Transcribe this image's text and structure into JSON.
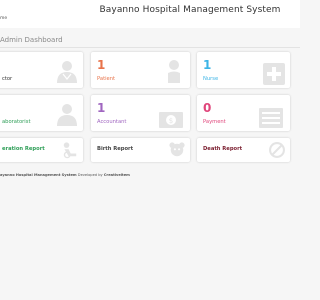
{
  "header": {
    "home_label": "me",
    "title": "Bayanno Hospital Management System"
  },
  "breadcrumb": "Admin Dashboard",
  "cards_row1": [
    {
      "number": "",
      "label": "ctor",
      "color": "#333333",
      "icon": "doctor-icon"
    },
    {
      "number": "1",
      "label": "Patient",
      "color": "#e8734a",
      "icon": "patient-icon"
    },
    {
      "number": "1",
      "label": "Nurse",
      "color": "#3cb4e6",
      "icon": "nurse-plus-icon"
    }
  ],
  "cards_row2": [
    {
      "number": "",
      "label": "aboratorist",
      "color": "#2e9e57",
      "icon": "laboratorist-icon"
    },
    {
      "number": "1",
      "label": "Accountant",
      "color": "#a066c0",
      "icon": "money-icon"
    },
    {
      "number": "0",
      "label": "Payment",
      "color": "#e0457b",
      "icon": "payment-list-icon"
    }
  ],
  "cards_row3": [
    {
      "label": "eration Report",
      "color": "#2e9e57",
      "icon": "operation-icon"
    },
    {
      "label": "Birth Report",
      "color": "#444444",
      "icon": "birth-icon"
    },
    {
      "label": "Death Report",
      "color": "#7a1d2e",
      "icon": "death-icon"
    }
  ],
  "footer": {
    "text": "ayanno Hospital Management System",
    "developed_by": "Developed by",
    "company": "Creativeltem"
  }
}
